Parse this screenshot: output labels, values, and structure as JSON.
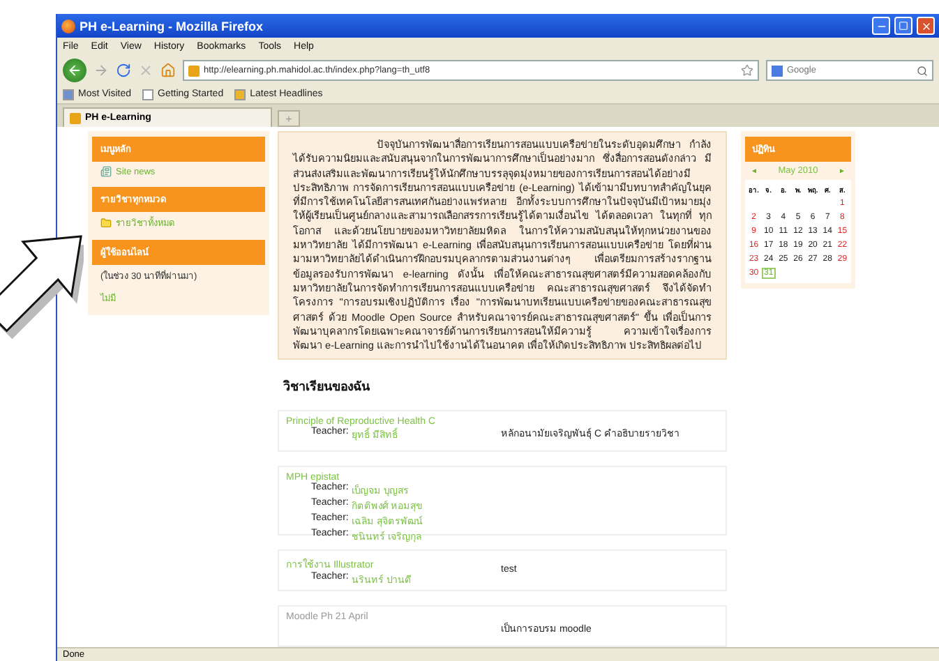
{
  "window": {
    "title": "PH e-Learning - Mozilla Firefox"
  },
  "menu": [
    "File",
    "Edit",
    "View",
    "History",
    "Bookmarks",
    "Tools",
    "Help"
  ],
  "address": {
    "url": "http://elearning.ph.mahidol.ac.th/index.php?lang=th_utf8"
  },
  "search": {
    "placeholder": "Google"
  },
  "bookmarks": [
    "Most Visited",
    "Getting Started",
    "Latest Headlines"
  ],
  "tabs": [
    {
      "label": "PH e-Learning",
      "selected": true
    }
  ],
  "new_tab": "+",
  "left_blocks": [
    {
      "title": "เมนูหลัก",
      "items": [
        {
          "kind": "news",
          "label": "Site news"
        }
      ]
    },
    {
      "title": "รายวิชาทุกหมวด",
      "items": [
        {
          "kind": "folder",
          "label": "รายวิชาทั้งหมด"
        }
      ]
    },
    {
      "title": "ผู้ใช้ออนไลน์",
      "items": [
        {
          "kind": "note",
          "label": "(ในช่วง 30 นาทีที่ผ่านมา)"
        },
        {
          "kind": "link",
          "label": "ไม่มี"
        }
      ]
    }
  ],
  "intro": "ปัจจุบันการพัฒนาสื่อการเรียนการสอนแบบเครือข่ายในระดับอุดมศึกษา กำลังได้รับความนิยมและสนับสนุนจากในการพัฒนาการศึกษาเป็นอย่างมาก ซึ่งสื่อการสอนดังกล่าว มีส่วนส่งเสริมและพัฒนาการเรียนรู้ให้นักศึกษาบรรลุจุดมุ่งหมายของการเรียนการสอนได้อย่างมีประสิทธิภาพ การจัดการเรียนการสอนแบบเครือข่าย (e-Learning) ได้เข้ามามีบทบาทสำคัญในยุคที่มีการใช้เทคโนโลยีสารสนเทศกันอย่างแพร่หลาย อีกทั้งระบบการศึกษาในปัจจุบันมีเป้าหมายมุ่งให้ผู้เรียนเป็นศูนย์กลางและสามารถเลือกสรรการเรียนรู้ได้ตามเงื่อนไข ได้ตลอดเวลา ในทุกที่ ทุกโอกาส และด้วยนโยบายของมหาวิทยาลัยมหิดล ในการให้ความสนับสนุนให้ทุกหน่วยงานของมหาวิทยาลัย ได้มีการพัฒนา e-Learning เพื่อสนับสนุนการเรียนการสอนแบบเครือข่าย โดยที่ผ่านมามหาวิทยาลัยได้ดำเนินการฝึกอบรมบุคลากรตามส่วนงานต่างๆ เพื่อเตรียมการสร้างรากฐานข้อมูลรองรับการพัฒนา e-learning ดังนั้น เพื่อให้คณะสาธารณสุขศาสตร์มีความสอดคล้องกับมหาวิทยาลัยในการจัดทำการเรียนการสอนแบบเครือข่าย คณะสาธารณสุขศาสตร์ จึงได้จัดทำโครงการ \"การอบรมเชิงปฏิบัติการ เรื่อง \"การพัฒนาบทเรียนแบบเครือข่ายของคณะสาธารณสุขศาสตร์ ด้วย Moodle Open Source สำหรับคณาจารย์คณะสาธารณสุขศาสตร์\" ขึ้น เพื่อเป็นการพัฒนาบุคลากรโดยเฉพาะคณาจารย์ด้านการเรียนการสอนให้มีความรู้ ความเข้าใจเรื่องการพัฒนา e-Learning และการนำไปใช้งานได้ในอนาคต เพื่อให้เกิดประสิทธิภาพ ประสิทธิผลต่อไป",
  "my_courses": {
    "heading": "วิชาเรียนของฉัน",
    "courses": [
      {
        "name": "Principle of Reproductive Health C",
        "teachers": [
          {
            "role": "Teacher:",
            "name": "ยุทธิ์ มีสิทธิ์"
          }
        ],
        "summary": "หลักอนามัยเจริญพันธุ์ C คำอธิบายรายวิชา"
      },
      {
        "name": "MPH epistat",
        "teachers": [
          {
            "role": "Teacher:",
            "name": "เบ็ญจม บุญสร"
          },
          {
            "role": "Teacher:",
            "name": "กิตติพงศ์ หอมสุข"
          },
          {
            "role": "Teacher:",
            "name": "เฉลิม สุจิตรพัฒน์"
          },
          {
            "role": "Teacher:",
            "name": "ชนินทร์ เจริญกุล"
          }
        ]
      },
      {
        "name": "การใช้งาน Illustrator",
        "teachers": [
          {
            "role": "Teacher:",
            "name": "นรินทร์ ปานดี"
          }
        ],
        "summary": "test"
      },
      {
        "name": "Moodle Ph 21 April",
        "summary": "เป็นการอบรม moodle"
      }
    ]
  },
  "calendar": {
    "title": "ปฏิทิน",
    "prev": "◄",
    "next": "►",
    "month": "May 2010",
    "weekdays": [
      "อา.",
      "จ.",
      "อ.",
      "พ.",
      "พฤ.",
      "ศ.",
      "ส."
    ],
    "weeks": [
      [
        {
          "d": "1",
          "today": false
        }
      ],
      [
        {
          "d": "2",
          "today": false
        },
        {
          "d": "3",
          "today": false
        },
        {
          "d": "4",
          "today": false
        },
        {
          "d": "5",
          "today": false
        },
        {
          "d": "6",
          "today": false
        },
        {
          "d": "7",
          "today": false
        },
        {
          "d": "8",
          "today": false
        }
      ],
      [
        {
          "d": "9",
          "today": false
        },
        {
          "d": "10",
          "today": false
        },
        {
          "d": "11",
          "today": false
        },
        {
          "d": "12",
          "today": false
        },
        {
          "d": "13",
          "today": false
        },
        {
          "d": "14",
          "today": false
        },
        {
          "d": "15",
          "today": false
        }
      ],
      [
        {
          "d": "16",
          "today": false
        },
        {
          "d": "17",
          "today": false
        },
        {
          "d": "18",
          "today": false
        },
        {
          "d": "19",
          "today": false
        },
        {
          "d": "20",
          "today": false
        },
        {
          "d": "21",
          "today": false
        },
        {
          "d": "22",
          "today": false
        }
      ],
      [
        {
          "d": "23",
          "today": false
        },
        {
          "d": "24",
          "today": false
        },
        {
          "d": "25",
          "today": false
        },
        {
          "d": "26",
          "today": false
        },
        {
          "d": "27",
          "today": false
        },
        {
          "d": "28",
          "today": false
        },
        {
          "d": "29",
          "today": false
        }
      ],
      [
        {
          "d": "30",
          "today": false
        },
        {
          "d": "31",
          "today": true
        }
      ]
    ]
  },
  "status_bar": "Done"
}
